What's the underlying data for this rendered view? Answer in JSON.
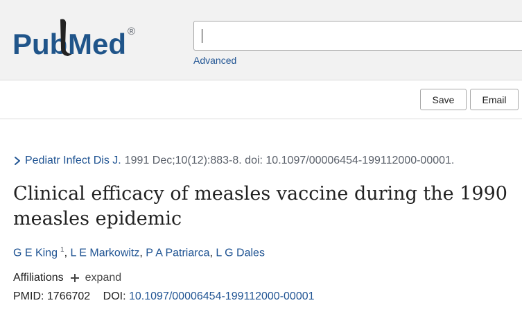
{
  "brand": {
    "logo_text_left": "Pub",
    "logo_text_right": "Med",
    "registered_mark": "®",
    "colors": {
      "pub_blue": "#20558a",
      "med_blue": "#20558a"
    }
  },
  "search": {
    "value": "",
    "placeholder": ""
  },
  "header": {
    "advanced_label": "Advanced"
  },
  "toolbar": {
    "save_label": "Save",
    "email_label": "Email"
  },
  "article": {
    "journal": "Pediatr Infect Dis J.",
    "citation_rest": "1991 Dec;10(12):883-8. doi: 10.1097/00006454-199112000-00001.",
    "title": "Clinical efficacy of measles vaccine during the 1990 measles epidemic",
    "authors": [
      {
        "name": "G E King",
        "sup": "1"
      },
      {
        "name": "L E Markowitz"
      },
      {
        "name": "P A Patriarca"
      },
      {
        "name": "L G Dales"
      }
    ],
    "author_separator": ",",
    "affiliations_label": "Affiliations",
    "expand_label": "expand",
    "pmid_label": "PMID:",
    "pmid": "1766702",
    "doi_label": "DOI:",
    "doi": "10.1097/00006454-199112000-00001"
  },
  "icons": {
    "chevron": "chevron-right-icon",
    "expand": "plus-icon"
  },
  "colors": {
    "link": "#205493",
    "header_bg": "#f2f2f2",
    "text": "#212121",
    "muted": "#5b616b"
  }
}
